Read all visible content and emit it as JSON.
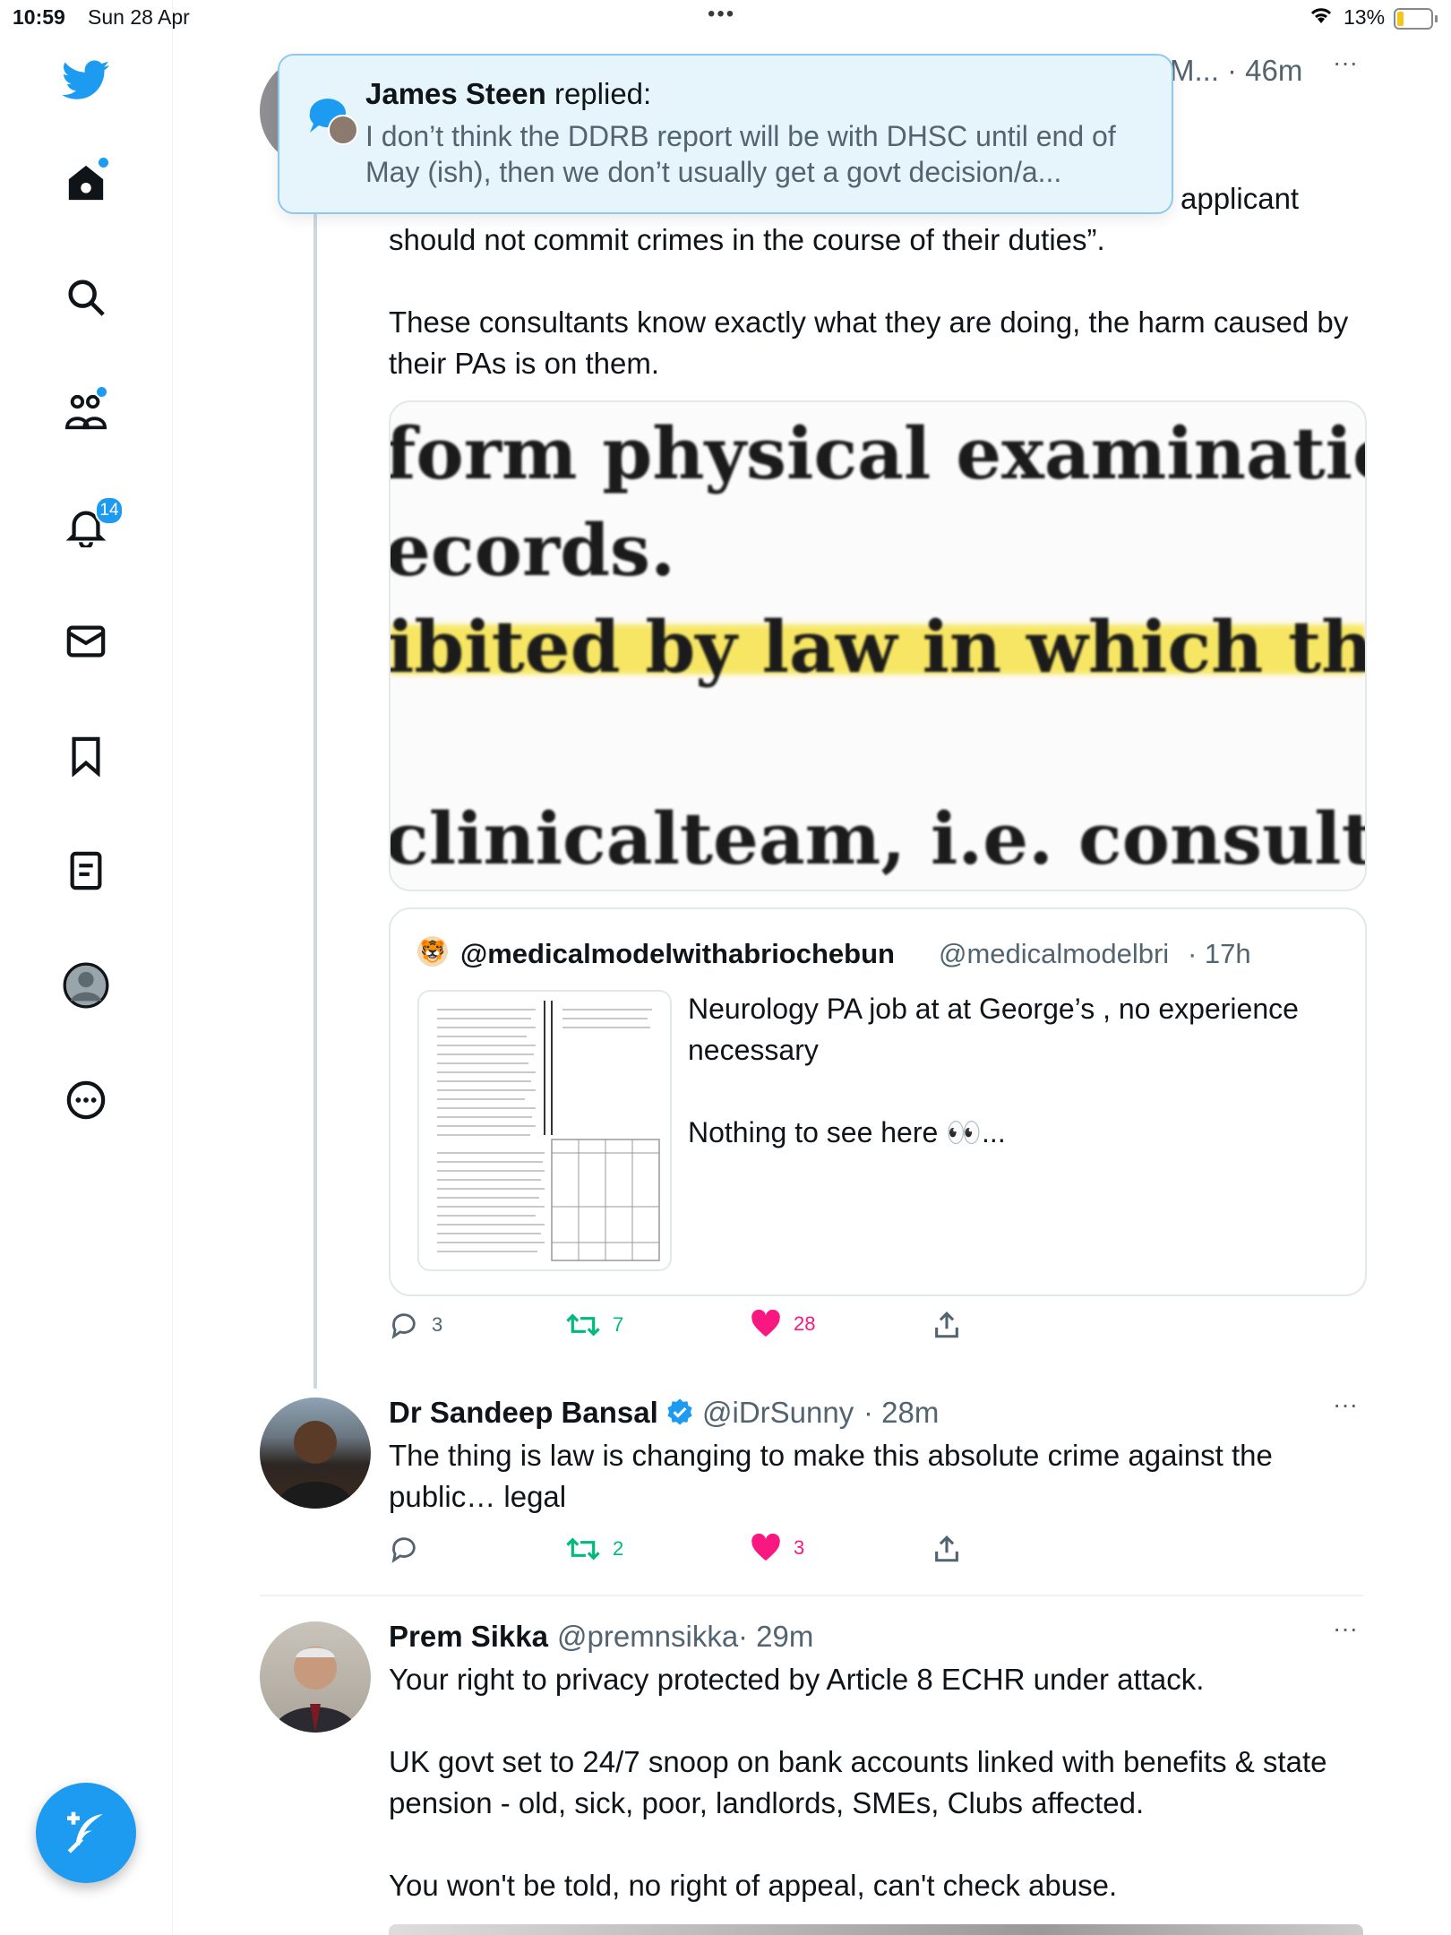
{
  "status_bar": {
    "time": "10:59",
    "date": "Sun 28 Apr",
    "battery": "13%"
  },
  "sidebar": {
    "items": [
      "twitter-logo",
      "home",
      "search",
      "communities",
      "notifications",
      "messages",
      "bookmarks",
      "lists",
      "profile",
      "more"
    ],
    "notifications_badge": "14"
  },
  "top_tweet": {
    "name_partial": "M...",
    "time": "· 46m",
    "text_line1_fragment": "applicant",
    "text": "should not commit crimes in the course of their duties”.\n\nThese consultants know exactly what they are doing, the harm caused by their PAs is on them.",
    "image_lines": [
      "form physical examinations of",
      "ecords.",
      "ibited by law in which the physi",
      "clinicalteam, i.e. consultants, j"
    ],
    "quote": {
      "display_name": "@medicalmodelwithabriochebun",
      "handle": "@medicalmodelbri",
      "time": "· 17h",
      "text": "Neurology PA job at at George’s , no experience necessary\n\nNothing to see here 👀..."
    },
    "actions": {
      "replies": "3",
      "retweets": "7",
      "likes": "28"
    }
  },
  "notification": {
    "author": "James Steen",
    "verb": "replied:",
    "message": "I don’t think the DDRB report will be with DHSC until end of May (ish), then we don’t usually get a govt decision/a..."
  },
  "tweets": [
    {
      "name": "Dr Sandeep Bansal",
      "handle": "@iDrSunny",
      "time": "· 28m",
      "text": "The thing is law is changing to make this absolute crime against the public… legal",
      "actions": {
        "replies": "",
        "retweets": "2",
        "likes": "3"
      }
    },
    {
      "name": "Prem Sikka",
      "handle": "@premnsikka",
      "time": "· 29m",
      "text": "Your right to privacy protected by Article 8 ECHR under attack.\n\nUK govt set to 24/7 snoop on bank accounts linked with benefits & state pension - old, sick, poor, landlords, SMEs, Clubs affected.\n\nYou won't be told, no right of appeal, can't check abuse."
    }
  ],
  "colors": {
    "accent": "#1d9bf0",
    "like": "#f91880",
    "retweet": "#00ba7c",
    "muted": "#536471"
  }
}
